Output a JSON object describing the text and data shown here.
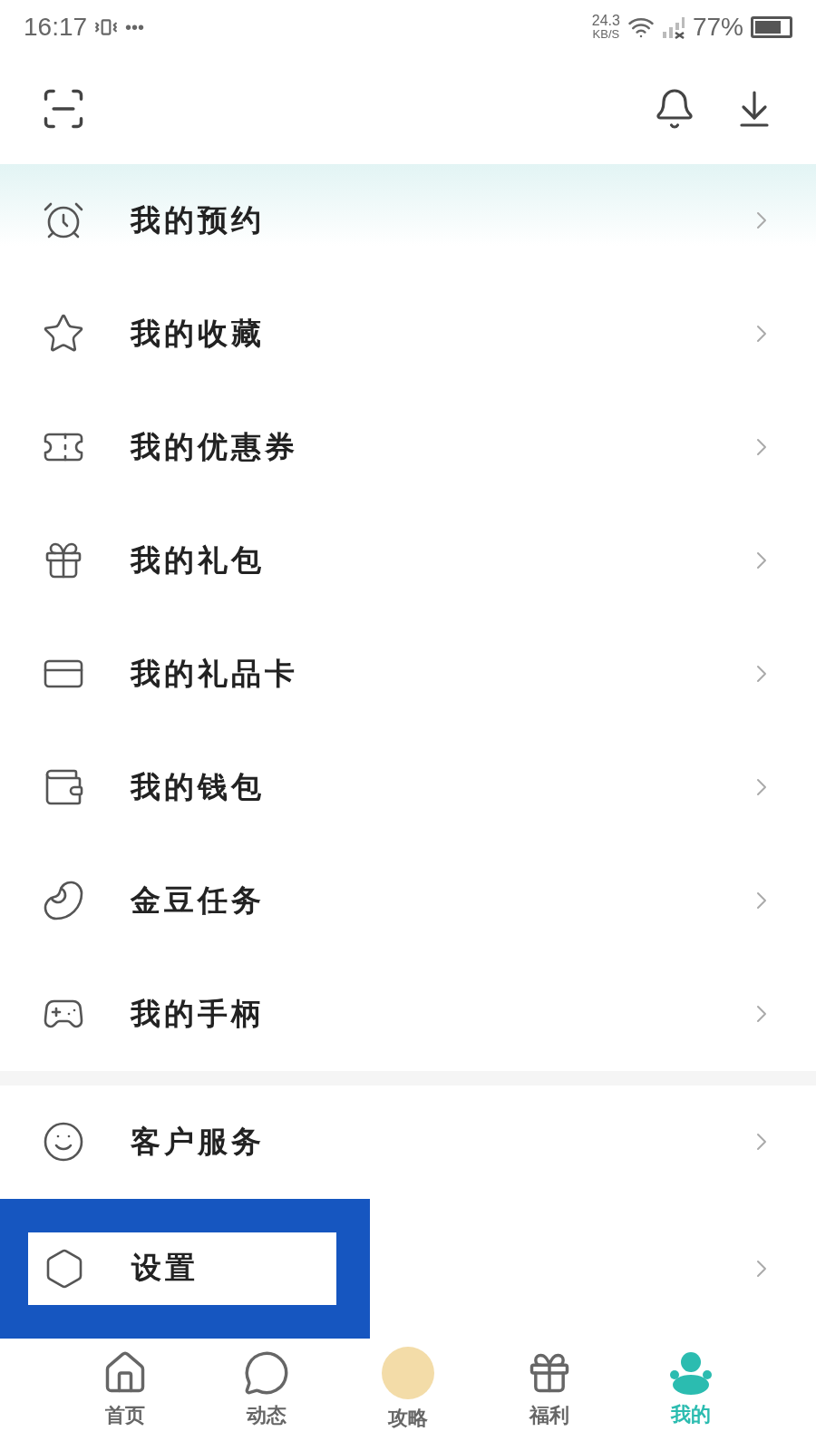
{
  "status_bar": {
    "time": "16:17",
    "more": "•••",
    "speed_value": "24.3",
    "speed_unit": "KB/S",
    "battery": "77%"
  },
  "menu_groups": [
    {
      "items": [
        {
          "label": "我的预约",
          "highlighted": false
        },
        {
          "label": "我的收藏",
          "highlighted": false
        },
        {
          "label": "我的优惠券",
          "highlighted": false
        },
        {
          "label": "我的礼包",
          "highlighted": false
        },
        {
          "label": "我的礼品卡",
          "highlighted": false
        },
        {
          "label": "我的钱包",
          "highlighted": false
        },
        {
          "label": "金豆任务",
          "highlighted": false
        },
        {
          "label": "我的手柄",
          "highlighted": false
        }
      ]
    },
    {
      "items": [
        {
          "label": "客户服务",
          "highlighted": false
        },
        {
          "label": "设置",
          "highlighted": true
        }
      ]
    }
  ],
  "bottom_nav": [
    {
      "label": "首页",
      "selected": false
    },
    {
      "label": "动态",
      "selected": false
    },
    {
      "label": "攻略",
      "selected": false,
      "kind": "avatar"
    },
    {
      "label": "福利",
      "selected": false
    },
    {
      "label": "我的",
      "selected": true
    }
  ]
}
